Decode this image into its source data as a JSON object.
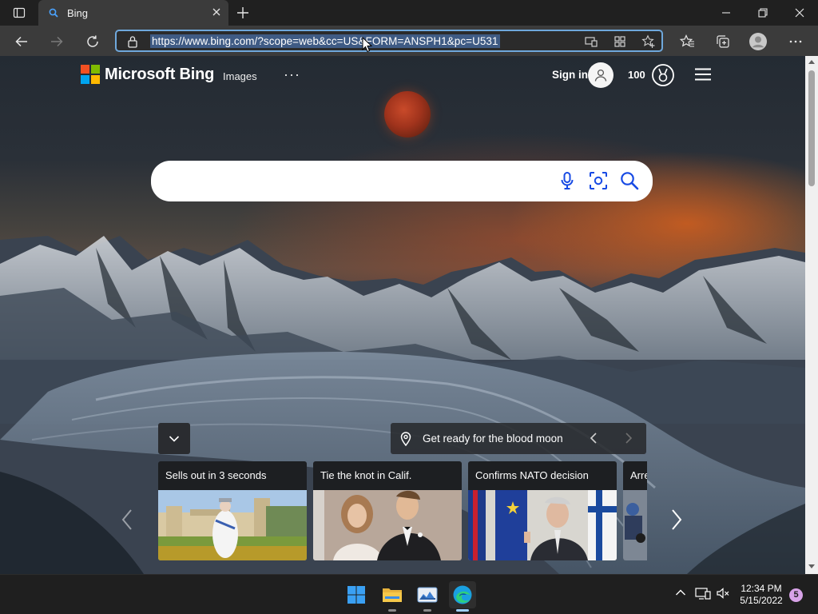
{
  "browser": {
    "tab": {
      "title": "Bing"
    },
    "address": {
      "url": "https://www.bing.com/?scope=web&cc=US&FORM=ANSPH1&pc=U531"
    }
  },
  "bing": {
    "brand": "Microsoft Bing",
    "nav": {
      "images": "Images",
      "more": "···"
    },
    "header": {
      "sign_in": "Sign in",
      "points": "100"
    },
    "search": {
      "value": "",
      "placeholder": ""
    },
    "caption": "Get ready for the blood moon",
    "cards": [
      {
        "title": "Sells out in 3 seconds"
      },
      {
        "title": "Tie the knot in Calif."
      },
      {
        "title": "Confirms NATO decision"
      },
      {
        "title": "Arre"
      }
    ]
  },
  "taskbar": {
    "time": "12:34 PM",
    "date": "5/15/2022",
    "notification_count": "5",
    "apps": [
      "start-icon",
      "file-explorer-icon",
      "photos-icon",
      "edge-icon"
    ]
  },
  "colors": {
    "address_highlight": "#3f5b84",
    "address_border": "#6fa8dc",
    "bing_blue": "#174ae4",
    "taskbar_bg": "#1f1f1f"
  }
}
